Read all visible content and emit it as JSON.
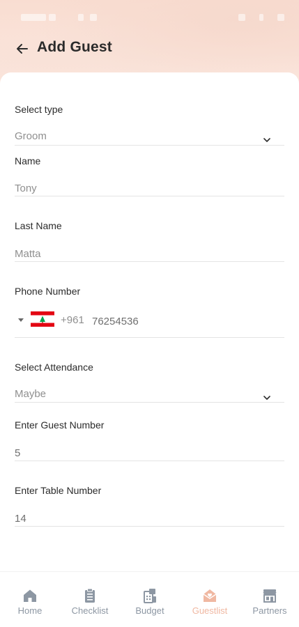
{
  "header": {
    "title": "Add Guest"
  },
  "form": {
    "type_label": "Select type",
    "type_value": "Groom",
    "name_label": "Name",
    "name_value": "Tony",
    "last_name_label": "Last Name",
    "last_name_value": "Matta",
    "phone_label": "Phone Number",
    "phone_dial_code": "+961",
    "phone_value": "76254536",
    "attendance_label": "Select Attendance",
    "attendance_value": "Maybe",
    "guest_number_label": "Enter Guest Number",
    "guest_number_value": "5",
    "table_number_label": "Enter Table Number",
    "table_number_value": "14"
  },
  "nav": {
    "items": [
      {
        "label": "Home",
        "icon": "home-icon"
      },
      {
        "label": "Checklist",
        "icon": "checklist-icon"
      },
      {
        "label": "Budget",
        "icon": "budget-icon"
      },
      {
        "label": "Guestlist",
        "icon": "guestlist-icon",
        "active": true
      },
      {
        "label": "Partners",
        "icon": "partners-icon"
      }
    ]
  },
  "colors": {
    "accent": "#f0b8a2",
    "nav_inactive": "#8d97a3",
    "header_bg": "#f9ddd1",
    "flag_red": "#e30613",
    "flag_green": "#00a651"
  }
}
